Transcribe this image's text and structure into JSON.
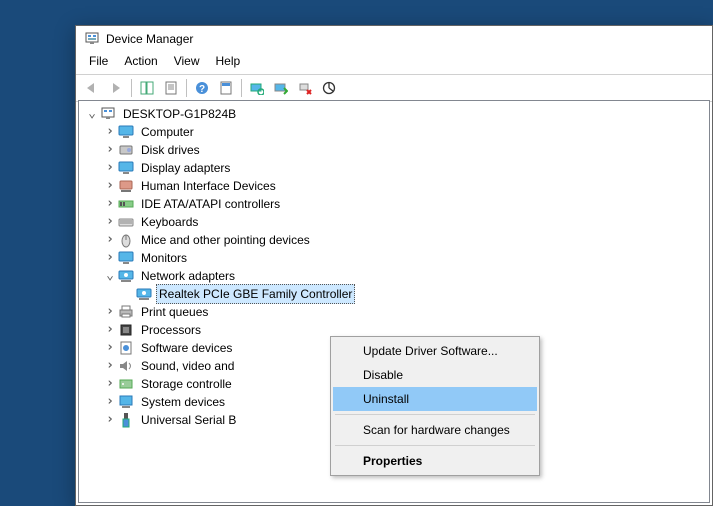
{
  "window": {
    "title": "Device Manager"
  },
  "menubar": [
    "File",
    "Action",
    "View",
    "Help"
  ],
  "root": {
    "label": "DESKTOP-G1P824B"
  },
  "nodes": [
    {
      "label": "Computer",
      "icon": "monitor",
      "expand": "closed"
    },
    {
      "label": "Disk drives",
      "icon": "disk",
      "expand": "closed"
    },
    {
      "label": "Display adapters",
      "icon": "monitor",
      "expand": "closed"
    },
    {
      "label": "Human Interface Devices",
      "icon": "hid",
      "expand": "closed"
    },
    {
      "label": "IDE ATA/ATAPI controllers",
      "icon": "ide",
      "expand": "closed"
    },
    {
      "label": "Keyboards",
      "icon": "keyboard",
      "expand": "closed"
    },
    {
      "label": "Mice and other pointing devices",
      "icon": "mouse",
      "expand": "closed"
    },
    {
      "label": "Monitors",
      "icon": "monitor",
      "expand": "closed"
    },
    {
      "label": "Network adapters",
      "icon": "net",
      "expand": "open"
    },
    {
      "label": "Print queues",
      "icon": "printer",
      "expand": "closed"
    },
    {
      "label": "Processors",
      "icon": "cpu",
      "expand": "closed"
    },
    {
      "label": "Software devices",
      "icon": "software",
      "expand": "closed"
    },
    {
      "label": "Sound, video and",
      "icon": "sound",
      "expand": "closed"
    },
    {
      "label": "Storage controlle",
      "icon": "storage",
      "expand": "closed"
    },
    {
      "label": "System devices",
      "icon": "system",
      "expand": "closed"
    },
    {
      "label": "Universal Serial B",
      "icon": "usb",
      "expand": "closed"
    }
  ],
  "selected_child": {
    "label": "Realtek PCIe GBE Family Controller",
    "icon": "net"
  },
  "context_menu": {
    "items": [
      {
        "label": "Update Driver Software...",
        "type": "item"
      },
      {
        "label": "Disable",
        "type": "item"
      },
      {
        "label": "Uninstall",
        "type": "item",
        "highlight": true
      },
      {
        "type": "sep"
      },
      {
        "label": "Scan for hardware changes",
        "type": "item"
      },
      {
        "type": "sep"
      },
      {
        "label": "Properties",
        "type": "item",
        "bold": true
      }
    ]
  }
}
